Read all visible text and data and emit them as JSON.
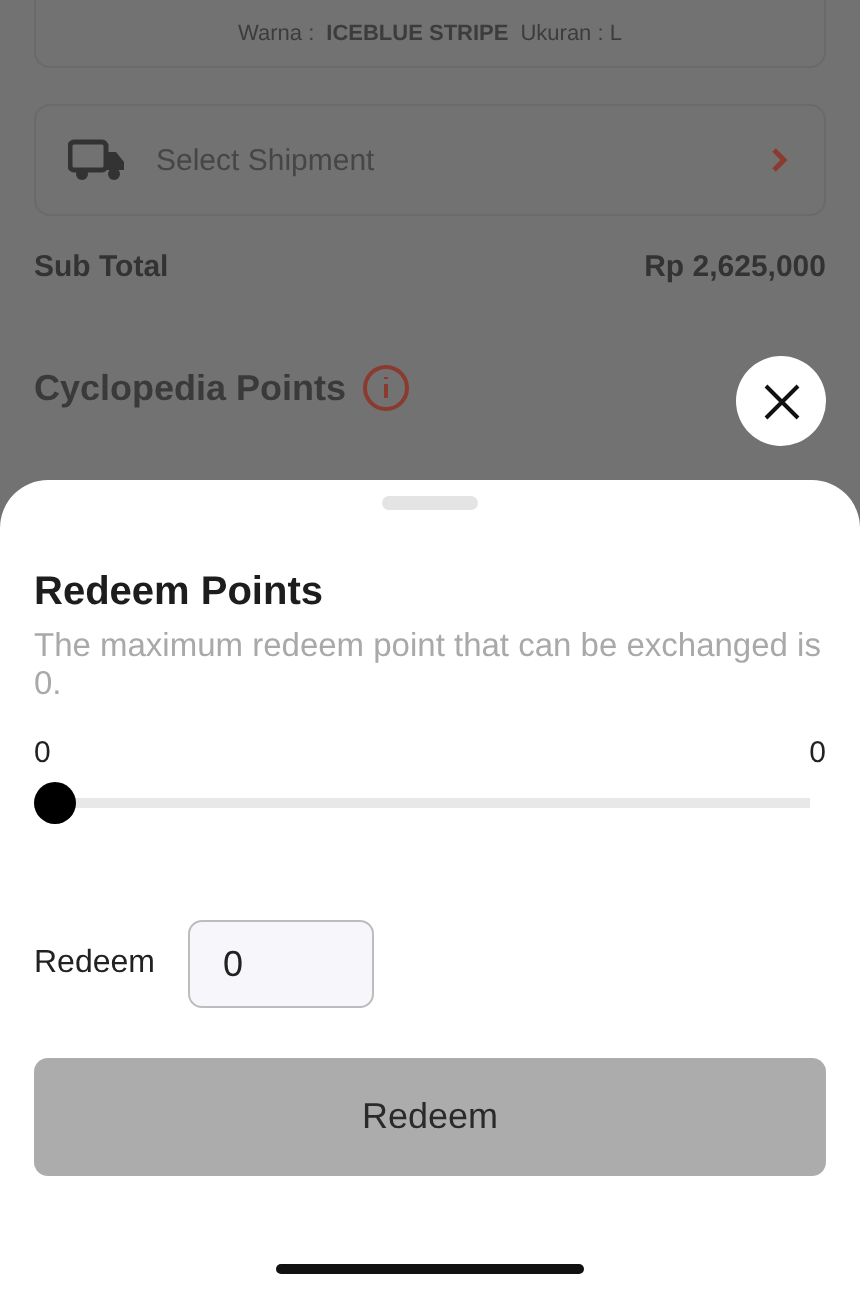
{
  "background": {
    "variant_label": "Warna :",
    "variant_color": "ICEBLUE STRIPE",
    "size_label": "Ukuran : L",
    "shipment": "Select Shipment",
    "subtotal_label": "Sub Total",
    "subtotal_value": "Rp 2,625,000",
    "points_title": "Cyclopedia Points"
  },
  "sheet": {
    "title": "Redeem Points",
    "description": "The maximum redeem point that can be exchanged is 0.",
    "slider": {
      "min_label": "0",
      "max_label": "0",
      "level": 0
    },
    "redeem_field": {
      "label": "Redeem",
      "value": "0"
    },
    "button": {
      "label": "Redeem",
      "disabled": true
    }
  }
}
